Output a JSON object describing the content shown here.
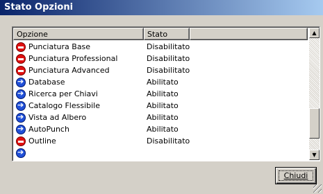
{
  "window": {
    "title": "Stato Opzioni"
  },
  "columns": {
    "option": "Opzione",
    "status": "Stato"
  },
  "items": [
    {
      "label": "Punciatura Base",
      "status": "Disabilitato",
      "icon": "red-disabled-icon"
    },
    {
      "label": "Punciatura Professional",
      "status": "Disabilitato",
      "icon": "red-disabled-icon"
    },
    {
      "label": "Punciatura Advanced",
      "status": "Disabilitato",
      "icon": "red-disabled-icon"
    },
    {
      "label": "Database",
      "status": "Abilitato",
      "icon": "blue-enabled-icon"
    },
    {
      "label": "Ricerca per Chiavi",
      "status": "Abilitato",
      "icon": "blue-enabled-icon"
    },
    {
      "label": "Catalogo Flessibile",
      "status": "Abilitato",
      "icon": "blue-enabled-icon"
    },
    {
      "label": "Vista ad Albero",
      "status": "Abilitato",
      "icon": "blue-enabled-icon"
    },
    {
      "label": "AutoPunch",
      "status": "Abilitato",
      "icon": "blue-enabled-icon"
    },
    {
      "label": "Outline",
      "status": "Disabilitato",
      "icon": "red-disabled-icon"
    }
  ],
  "buttons": {
    "close": "Chiudi"
  },
  "colors": {
    "title_start": "#0a246a",
    "title_end": "#a6caf0",
    "disabled": "#e01010",
    "enabled": "#2050d8"
  }
}
